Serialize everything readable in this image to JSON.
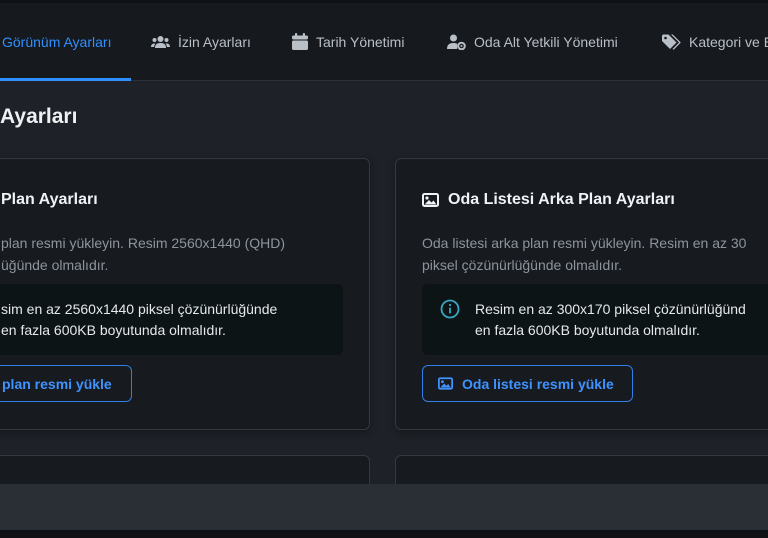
{
  "tabs": [
    {
      "label": "Görünüm Ayarları",
      "icon": "appearance-icon",
      "active": true
    },
    {
      "label": "İzin Ayarları",
      "icon": "users-icon",
      "active": false
    },
    {
      "label": "Tarih Yönetimi",
      "icon": "calendar-icon",
      "active": false
    },
    {
      "label": "Oda Alt Yetkili Yönetimi",
      "icon": "user-gear-icon",
      "active": false
    },
    {
      "label": "Kategori ve E",
      "icon": "tags-icon",
      "active": false
    }
  ],
  "page": {
    "title": "Ayarları"
  },
  "cards": [
    {
      "title": "Plan Ayarları",
      "desc_line1": "plan resmi yükleyin. Resim 2560x1440 (QHD)",
      "desc_line2": "üğünde olmalıdır.",
      "info_line1": "sim en az 2560x1440 piksel çözünürlüğünde",
      "info_line2": "en fazla 600KB boyutunda olmalıdır.",
      "button_label": "plan resmi yükle"
    },
    {
      "title": "Oda Listesi Arka Plan Ayarları",
      "icon": "image-icon",
      "desc_line1": "Oda listesi arka plan resmi yükleyin. Resim en az 30",
      "desc_line2": "piksel çözünürlüğünde olmalıdır.",
      "info_icon": "info-icon",
      "info_line1": "Resim en az 300x170 piksel çözünürlüğünd",
      "info_line2": "en fazla 600KB boyutunda olmalıdır.",
      "button_label": "Oda listesi resmi yükle",
      "button_icon": "image-icon"
    }
  ],
  "colors": {
    "accent": "#2f8fff",
    "info_icon": "#39a7c4",
    "background": "#1e2127",
    "card": "#171a1f"
  }
}
